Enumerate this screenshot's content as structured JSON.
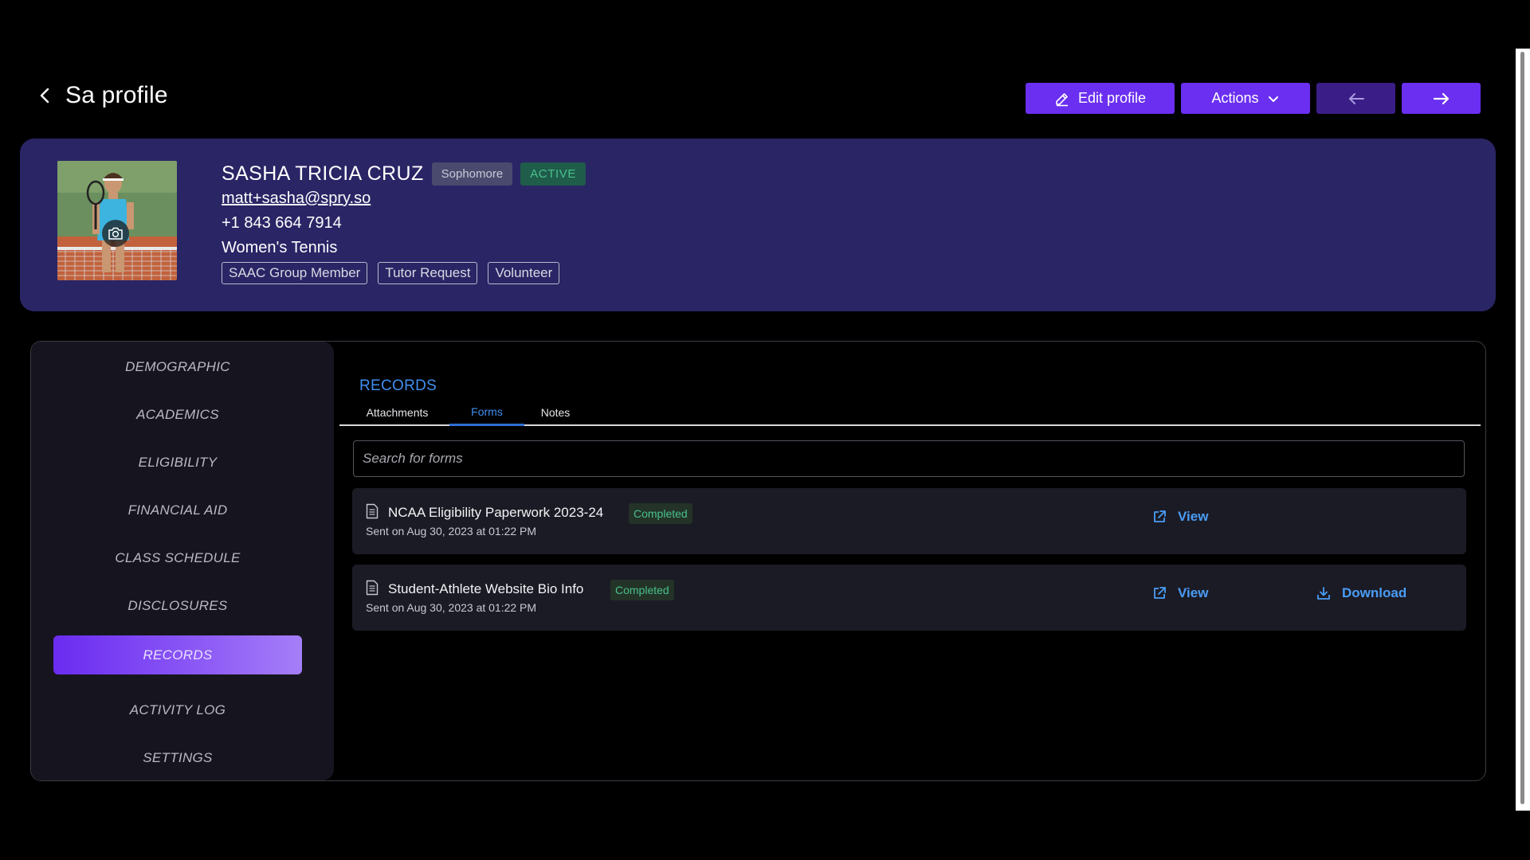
{
  "header": {
    "title": "Sa profile",
    "edit_label": "Edit profile",
    "actions_label": "Actions"
  },
  "profile": {
    "name": "SASHA TRICIA CRUZ",
    "class_year": "Sophomore",
    "status": "ACTIVE",
    "email": "matt+sasha@spry.so",
    "phone": "+1 843 664 7914",
    "sport": "Women's Tennis",
    "tags": [
      "SAAC Group Member",
      "Tutor Request",
      "Volunteer"
    ]
  },
  "sidebar": {
    "items": [
      {
        "label": "DEMOGRAPHIC"
      },
      {
        "label": "ACADEMICS"
      },
      {
        "label": "ELIGIBILITY"
      },
      {
        "label": "FINANCIAL AID"
      },
      {
        "label": "CLASS SCHEDULE"
      },
      {
        "label": "DISCLOSURES"
      },
      {
        "label": "RECORDS"
      },
      {
        "label": "ACTIVITY LOG"
      },
      {
        "label": "SETTINGS"
      }
    ],
    "active": "RECORDS"
  },
  "records": {
    "title": "RECORDS",
    "tabs": [
      "Attachments",
      "Forms",
      "Notes"
    ],
    "active_tab": "Forms",
    "search_placeholder": "Search for forms",
    "forms": [
      {
        "name": "NCAA Eligibility Paperwork 2023-24",
        "status": "Completed",
        "sent": "Sent on Aug 30, 2023 at 01:22 PM",
        "view_label": "View"
      },
      {
        "name": "Student-Athlete Website Bio Info",
        "status": "Completed",
        "sent": "Sent on Aug 30, 2023 at 01:22 PM",
        "view_label": "View",
        "download_label": "Download"
      }
    ]
  },
  "colors": {
    "accent": "#6a2ff0",
    "card": "#2a2565",
    "link": "#4a9df5",
    "success": "#49c08c"
  },
  "icons": {
    "back": "chevron-left-icon",
    "edit": "pencil-icon",
    "actions": "chevron-down-icon",
    "prev": "arrow-left-icon",
    "next": "arrow-right-icon",
    "camera": "camera-icon",
    "document": "document-icon",
    "view": "external-link-icon",
    "download": "download-icon"
  }
}
